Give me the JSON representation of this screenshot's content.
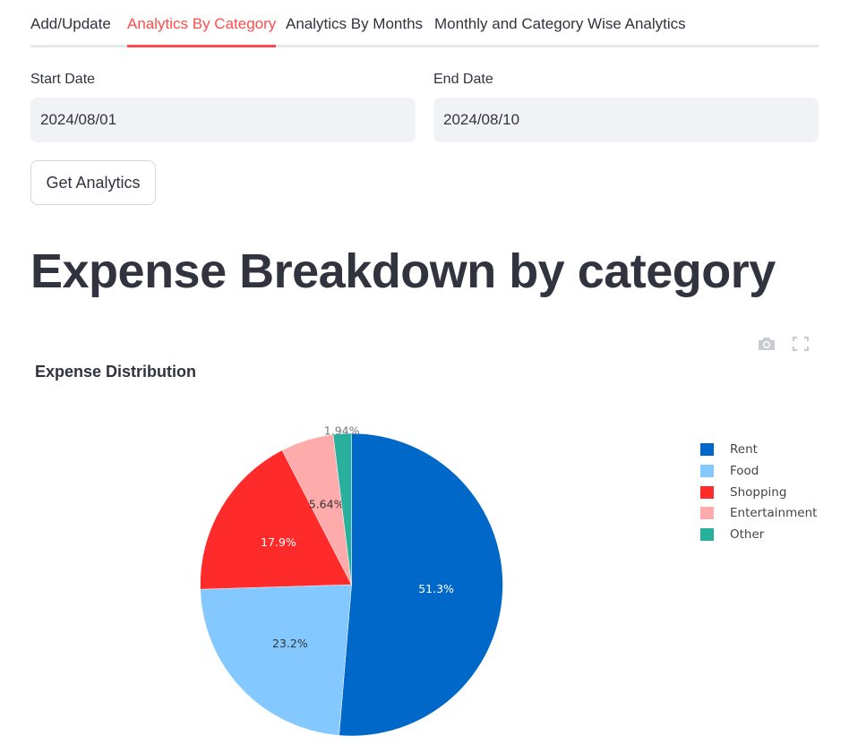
{
  "tabs": [
    {
      "label": "Add/Update",
      "active": false
    },
    {
      "label": "Analytics By Category",
      "active": true
    },
    {
      "label": "Analytics By Months",
      "active": false
    },
    {
      "label": "Monthly and Category Wise Analytics",
      "active": false
    }
  ],
  "form": {
    "start_label": "Start Date",
    "start_value": "2024/08/01",
    "end_label": "End Date",
    "end_value": "2024/08/10",
    "button_label": "Get Analytics"
  },
  "page_title": "Expense Breakdown by category",
  "toolbar": {
    "icons": [
      "camera-icon",
      "fullscreen-icon"
    ]
  },
  "colors": {
    "accent": "#ff4b4b",
    "text": "#31333f",
    "input_bg": "#f0f2f6"
  },
  "chart_data": {
    "type": "pie",
    "title": "Expense Distribution",
    "categories": [
      "Rent",
      "Food",
      "Shopping",
      "Entertainment",
      "Other"
    ],
    "values": [
      51.3,
      23.2,
      17.9,
      5.64,
      1.94
    ],
    "labels": [
      "51.3%",
      "23.2%",
      "17.9%",
      "5.64%",
      "1.94%"
    ],
    "colors": [
      "#0068c9",
      "#83c9ff",
      "#ff2b2b",
      "#ffabab",
      "#29b09d"
    ],
    "legend_position": "right"
  }
}
